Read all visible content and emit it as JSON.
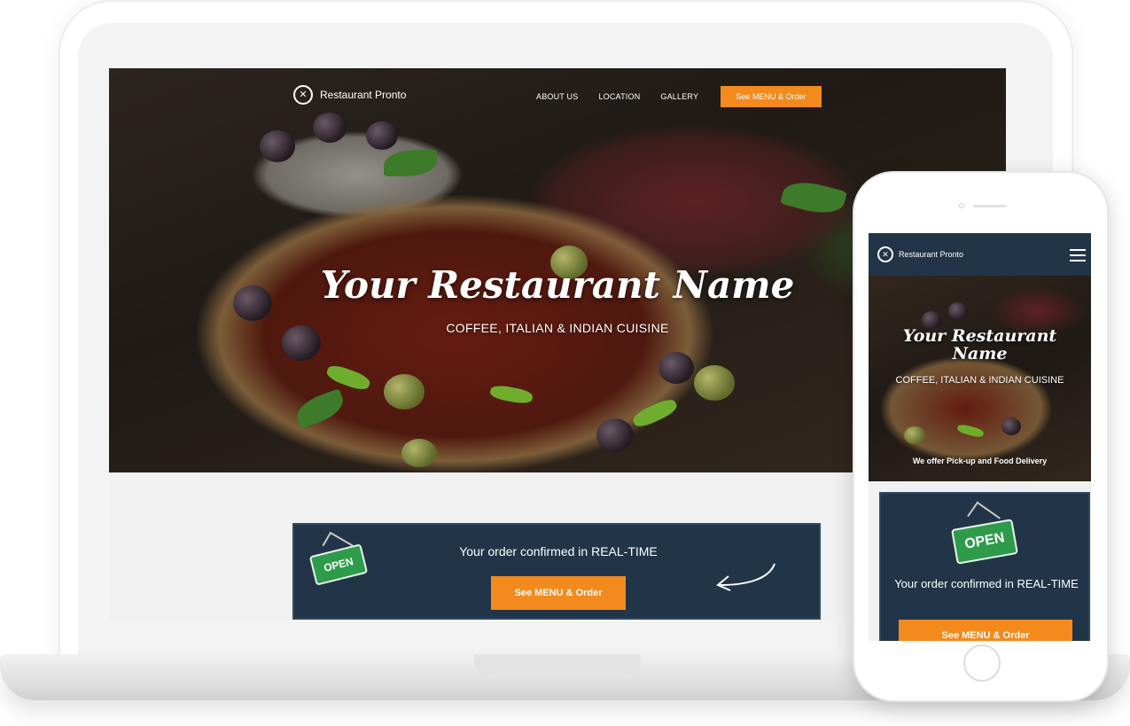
{
  "desktop": {
    "brand": "Restaurant Pronto",
    "nav": {
      "links": [
        "ABOUT US",
        "LOCATION",
        "GALLERY"
      ],
      "cta": "See MENU & Order"
    },
    "hero": {
      "title": "Your Restaurant Name",
      "subtitle": "COFFEE, ITALIAN & INDIAN CUISINE"
    },
    "order": {
      "sign": "OPEN",
      "text": "Your order confirmed in REAL-TIME",
      "button": "See MENU & Order"
    }
  },
  "mobile": {
    "brand": "Restaurant Pronto",
    "hero": {
      "title": "Your Restaurant Name",
      "subtitle": "COFFEE, ITALIAN & INDIAN CUISINE",
      "delivery": "We offer Pick-up and Food Delivery"
    },
    "order": {
      "sign": "OPEN",
      "text": "Your order confirmed in REAL-TIME",
      "button": "See MENU & Order"
    }
  },
  "icons": {
    "logo": "fork-knife-logo-icon",
    "menu": "hamburger-menu-icon",
    "arrow": "curved-arrow-icon"
  },
  "colors": {
    "accent": "#f28a1e",
    "navy": "#223548",
    "open_green": "#2e9b4a"
  }
}
